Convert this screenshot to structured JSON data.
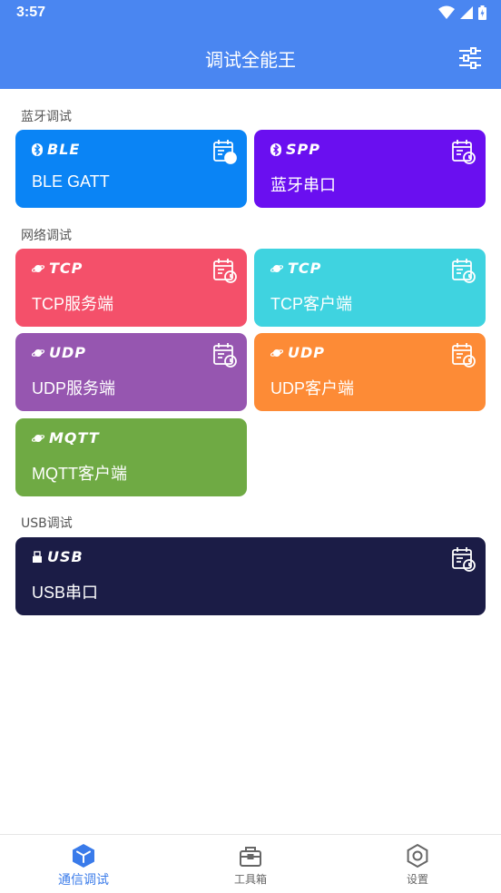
{
  "status_bar": {
    "time": "3:57"
  },
  "app_bar": {
    "title": "调试全能王"
  },
  "sections": [
    {
      "label": "蓝牙调试"
    },
    {
      "label": "网络调试"
    },
    {
      "label": "USB调试"
    }
  ],
  "cards": [
    {
      "badge": "BLE",
      "name": "BLE GATT",
      "color": "#0a84f5",
      "icon": "bluetooth-icon"
    },
    {
      "badge": "SPP",
      "name": "蓝牙串口",
      "color": "#6a0ff0",
      "icon": "bluetooth-icon"
    },
    {
      "badge": "TCP",
      "name": "TCP服务端",
      "color": "#f4506a",
      "icon": "planet-icon"
    },
    {
      "badge": "TCP",
      "name": "TCP客户端",
      "color": "#3fd3e0",
      "icon": "planet-icon"
    },
    {
      "badge": "UDP",
      "name": "UDP服务端",
      "color": "#9656b0",
      "icon": "planet-icon"
    },
    {
      "badge": "UDP",
      "name": "UDP客户端",
      "color": "#fd8b36",
      "icon": "planet-icon"
    },
    {
      "badge": "MQTT",
      "name": "MQTT客户端",
      "color": "#6faa44",
      "icon": "planet-icon"
    },
    {
      "badge": "USB",
      "name": "USB串口",
      "color": "#1b1c46",
      "icon": "usb-icon"
    }
  ],
  "bottom_nav": [
    {
      "label": "通信调试",
      "icon": "cube-icon",
      "active": true
    },
    {
      "label": "工具箱",
      "icon": "toolbox-icon",
      "active": false
    },
    {
      "label": "设置",
      "icon": "gear-icon",
      "active": false
    }
  ],
  "colors": {
    "primary": "#4a86f1",
    "nav_active": "#3a7bea",
    "nav_inactive": "#666666"
  }
}
